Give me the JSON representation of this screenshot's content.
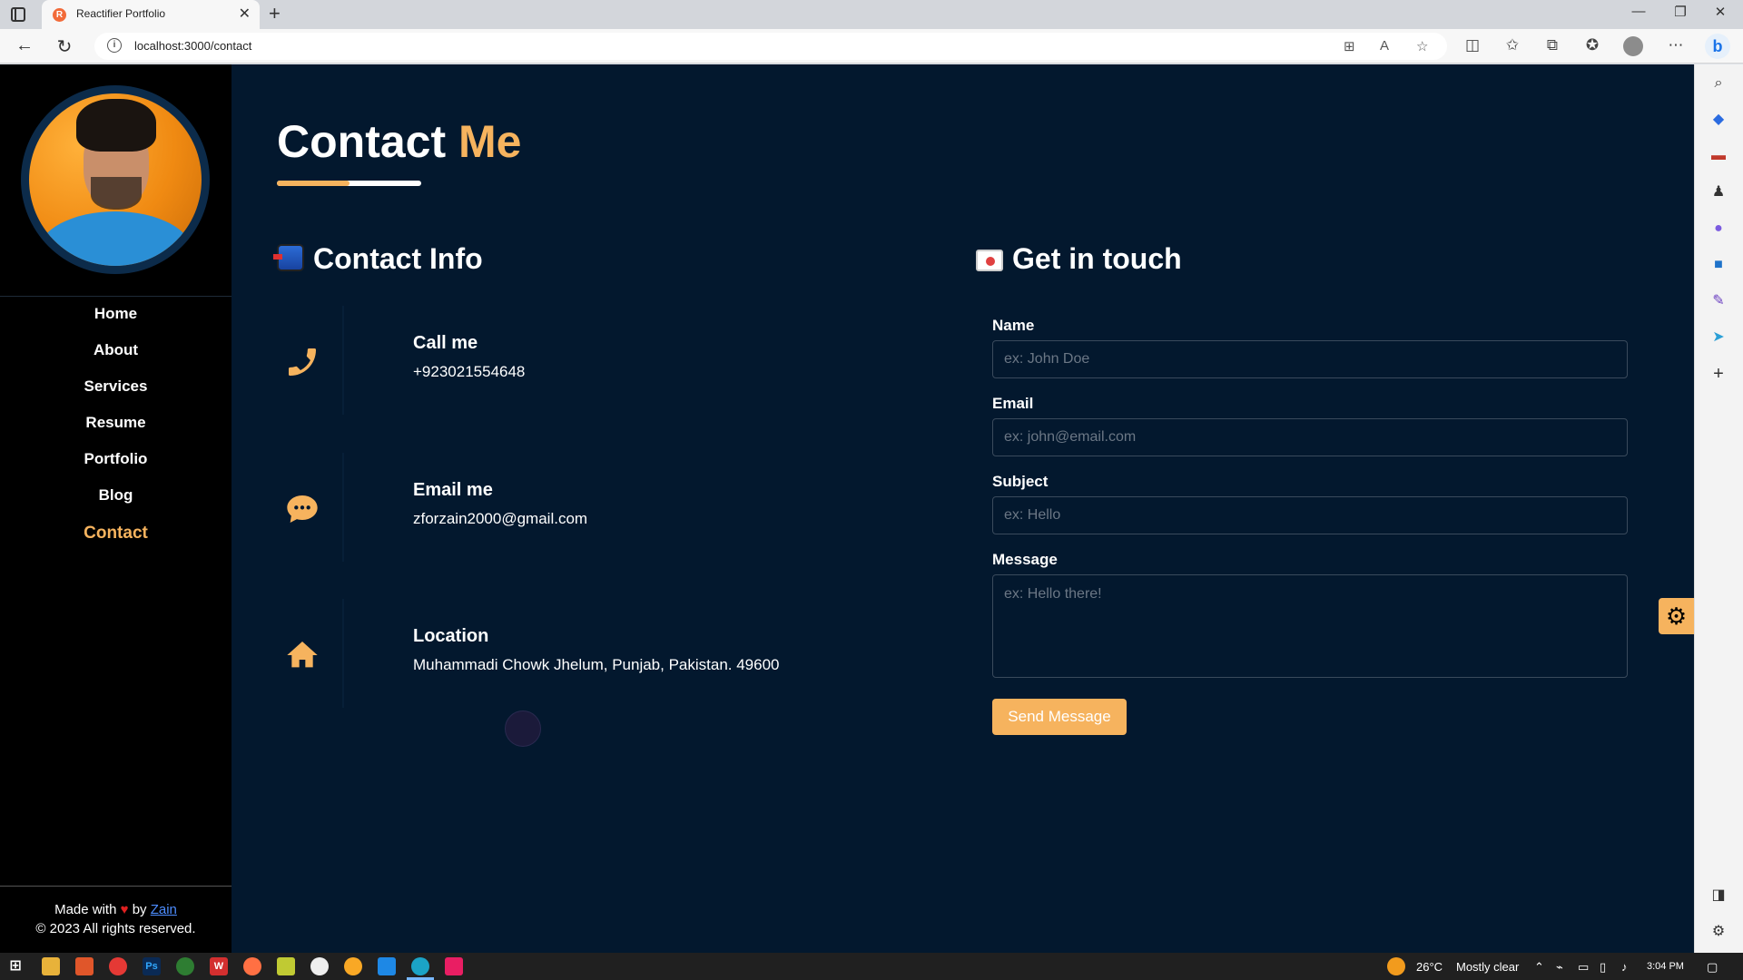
{
  "browser": {
    "tab_title": "Reactifier Portfolio",
    "tab_favicon": "R",
    "url": "localhost:3000/contact"
  },
  "sidebar": {
    "nav": [
      {
        "label": "Home"
      },
      {
        "label": "About"
      },
      {
        "label": "Services"
      },
      {
        "label": "Resume"
      },
      {
        "label": "Portfolio"
      },
      {
        "label": "Blog"
      },
      {
        "label": "Contact"
      }
    ],
    "active": "Contact",
    "footer_made_with": "Made with",
    "footer_by": "by",
    "footer_author": "Zain",
    "footer_copyright": "© 2023 All rights reserved."
  },
  "page": {
    "title_main": "Contact",
    "title_accent": "Me",
    "contact_info_title": "Contact Info",
    "get_in_touch_title": "Get in touch",
    "contact_items": [
      {
        "icon": "phone-icon",
        "heading": "Call me",
        "value": "+923021554648"
      },
      {
        "icon": "chat-icon",
        "heading": "Email me",
        "value": "zforzain2000@gmail.com"
      },
      {
        "icon": "home-icon",
        "heading": "Location",
        "value": "Muhammadi Chowk Jhelum, Punjab, Pakistan. 49600"
      }
    ],
    "form": {
      "name_label": "Name",
      "name_placeholder": "ex: John Doe",
      "email_label": "Email",
      "email_placeholder": "ex: john@email.com",
      "subject_label": "Subject",
      "subject_placeholder": "ex: Hello",
      "message_label": "Message",
      "message_placeholder": "ex: Hello there!",
      "submit_label": "Send Message"
    }
  },
  "taskbar": {
    "temperature": "26°C",
    "weather": "Mostly clear",
    "time": "3:04 PM"
  },
  "colors": {
    "accent": "#f6b35e",
    "background": "#03182e",
    "sidebar": "#000000"
  }
}
